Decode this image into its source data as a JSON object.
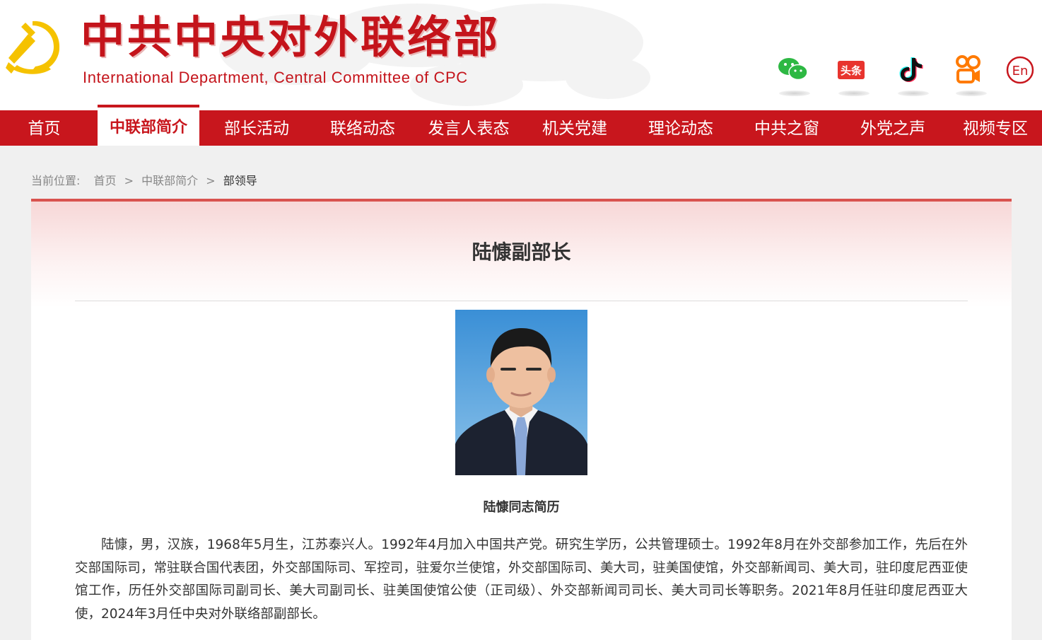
{
  "header": {
    "title_cn": "中共中央对外联络部",
    "title_en": "International Department, Central Committee of CPC",
    "social": [
      {
        "icon": "wechat-icon"
      },
      {
        "icon": "toutiao-icon",
        "label": "头条"
      },
      {
        "icon": "douyin-icon"
      },
      {
        "icon": "kuaishou-icon"
      },
      {
        "icon": "english-icon",
        "label": "En"
      }
    ]
  },
  "nav": {
    "items": [
      "首页",
      "中联部简介",
      "部长活动",
      "联络动态",
      "发言人表态",
      "机关党建",
      "理论动态",
      "中共之窗",
      "外党之声",
      "视频专区"
    ],
    "active": "中联部简介"
  },
  "breadcrumb": {
    "prefix": "当前位置:",
    "items": [
      "首页",
      "中联部简介",
      "部领导"
    ],
    "separator": ">"
  },
  "article": {
    "title": "陆慷副部长",
    "caption": "陆慷同志简历",
    "bio": "陆慷，男，汉族，1968年5月生，江苏泰兴人。1992年4月加入中国共产党。研究生学历，公共管理硕士。1992年8月在外交部参加工作，先后在外交部国际司，常驻联合国代表团，外交部国际司、军控司，驻爱尔兰使馆，外交部国际司、美大司，驻美国使馆，外交部新闻司、美大司，驻印度尼西亚使馆工作，历任外交部国际司副司长、美大司副司长、驻美国使馆公使（正司级）、外交部新闻司司长、美大司司长等职务。2021年8月任驻印度尼西亚大使，2024年3月任中央对外联络部副部长。"
  },
  "colors": {
    "brand_red": "#c8161d",
    "title_red": "#c4141b",
    "emblem_gold": "#f5c200"
  }
}
